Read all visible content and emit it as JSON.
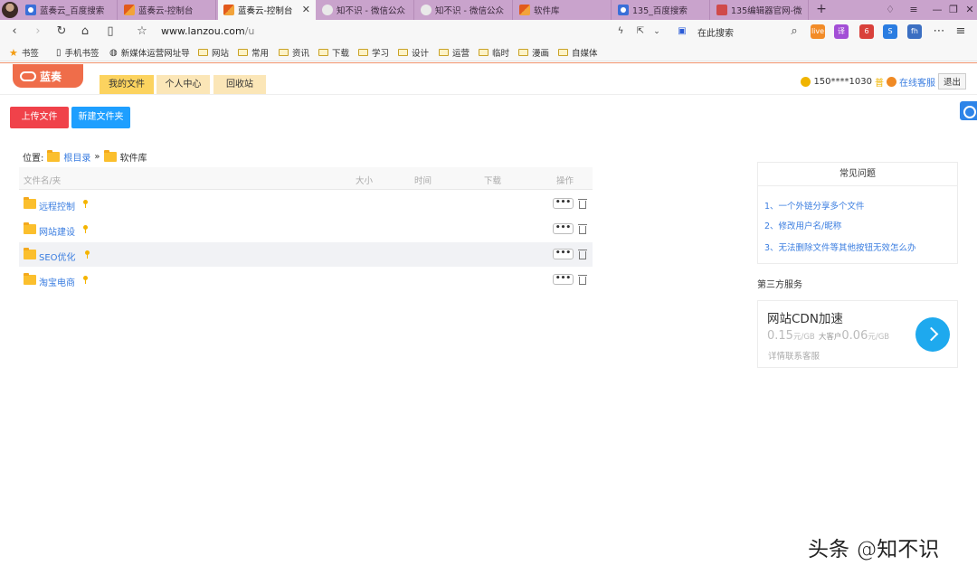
{
  "browser": {
    "tabs": [
      {
        "label": "蓝奏云_百度搜索",
        "favicon": "baidu-paw-icon"
      },
      {
        "label": "蓝奏云-控制台",
        "favicon": "lanzou-flag-icon"
      },
      {
        "label": "蓝奏云-控制台",
        "favicon": "lanzou-flag-icon",
        "active": true
      },
      {
        "label": "知不识 - 微信公众",
        "favicon": "wechat-icon"
      },
      {
        "label": "知不识 - 微信公众",
        "favicon": "wechat-icon"
      },
      {
        "label": "软件库",
        "favicon": "lanzou-flag-icon"
      },
      {
        "label": "135_百度搜索",
        "favicon": "baidu-paw-icon"
      },
      {
        "label": "135编辑器官网-微",
        "favicon": "site135-icon"
      }
    ],
    "new_tab": "+",
    "address": {
      "host": "www.lanzou.com",
      "path": "/u"
    },
    "search_placeholder": "在此搜索",
    "extensions": [
      {
        "label": "live",
        "color": "#f28c28"
      },
      {
        "label": "译",
        "color": "#a34fd6"
      },
      {
        "label": "6",
        "color": "#d9413b"
      },
      {
        "label": "S",
        "color": "#2a7de1"
      },
      {
        "label": "fh",
        "color": "#3b6fc2"
      }
    ],
    "bookmarks": [
      "书签",
      "手机书签",
      "新媒体运营网址导",
      "网站",
      "常用",
      "资讯",
      "下载",
      "学习",
      "设计",
      "运营",
      "临时",
      "漫画",
      "自媒体"
    ]
  },
  "site": {
    "logo_text": "蓝奏",
    "nav_tabs": [
      "我的文件",
      "个人中心",
      "回收站"
    ],
    "user": {
      "phone": "150****1030",
      "level": "普",
      "service": "在线客服",
      "logout": "退出"
    },
    "actions": {
      "upload": "上传文件",
      "new_folder": "新建文件夹"
    },
    "breadcrumb": {
      "label": "位置:",
      "root": "根目录",
      "sep": "»",
      "current": "软件库"
    },
    "table_headers": {
      "name": "文件名/夹",
      "size": "大小",
      "time": "时间",
      "downloads": "下载",
      "ops": "操作"
    },
    "files": [
      {
        "name": "远程控制"
      },
      {
        "name": "网站建设"
      },
      {
        "name": "SEO优化"
      },
      {
        "name": "淘宝电商"
      }
    ],
    "more_label": "•••",
    "faq": {
      "title": "常见问题",
      "items": [
        "1、一个外链分享多个文件",
        "2、修改用户名/昵称",
        "3、无法删除文件等其他按钮无效怎么办"
      ]
    },
    "third_party": {
      "title": "第三方服务",
      "cdn_title": "网站CDN加速",
      "price": {
        "p1": "0.15",
        "u1": "元/GB",
        "mid": "大客户",
        "p2": "0.06",
        "u2": "元/GB"
      },
      "contact": "详情联系客服"
    }
  },
  "watermark": "头条 @知不识"
}
